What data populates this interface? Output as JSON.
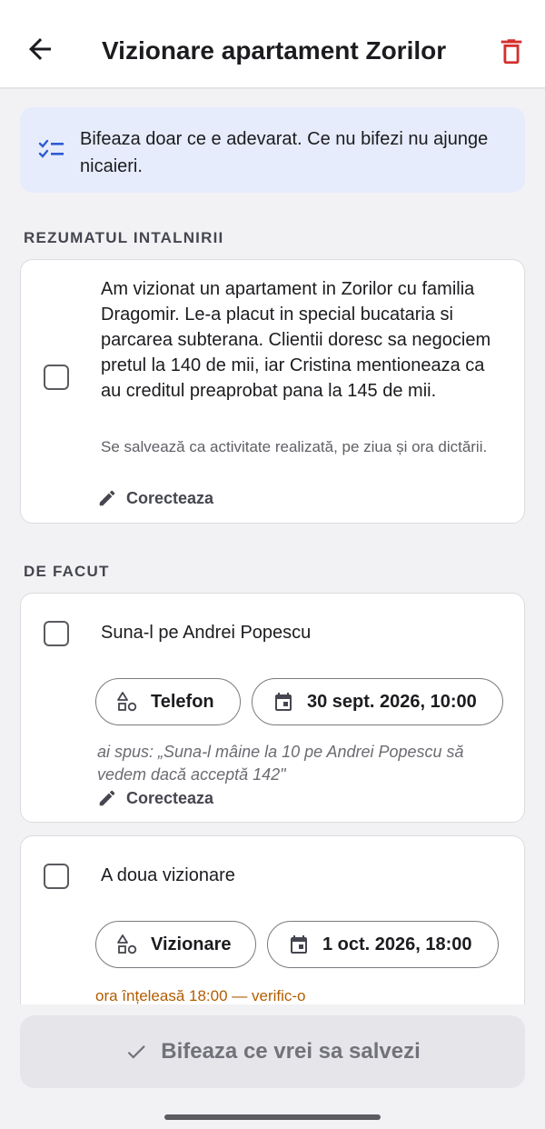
{
  "appbar": {
    "title": "Vizionare apartament Zorilor",
    "back_icon": "arrow-back-icon",
    "delete_icon": "trash-icon",
    "delete_color": "#d32f2f"
  },
  "info_banner": {
    "icon": "checklist-icon",
    "text": "Bifeaza doar ce e adevarat. Ce nu bifezi nu ajunge nicaieri.",
    "background": "#e6ecfb"
  },
  "summary_section": {
    "heading": "REZUMATUL INTALNIRII",
    "text": "Am vizionat un apartament in Zorilor cu familia Dragomir. Le-a placut in special bucataria si parcarea subterana. Clientii doresc sa negociem pretul la 140 de mii, iar Cristina mentioneaza ca au creditul preaprobat pana la 145 de mii.",
    "note": "Se salvează ca activitate realizată, pe ziua și ora dictării.",
    "edit_label": "Corecteaza"
  },
  "todo_section": {
    "heading": "DE FACUT",
    "tasks": [
      {
        "title": "Suna-l pe Andrei Popescu",
        "type_label": "Telefon",
        "date_label": "30 sept. 2026, 10:00",
        "quote": "ai spus: „Suna-l mâine la 10 pe Andrei Popescu să vedem dacă acceptă 142\"",
        "edit_label": "Corecteaza"
      },
      {
        "title": "A doua vizionare",
        "type_label": "Vizionare",
        "date_label": "1 oct. 2026, 18:00",
        "warning": "ora înțeleasă 18:00 — verific-o",
        "warning_color": "#b35c00"
      }
    ]
  },
  "save_button": {
    "label": "Bifeaza ce vrei sa salvezi",
    "icon": "check-icon"
  }
}
